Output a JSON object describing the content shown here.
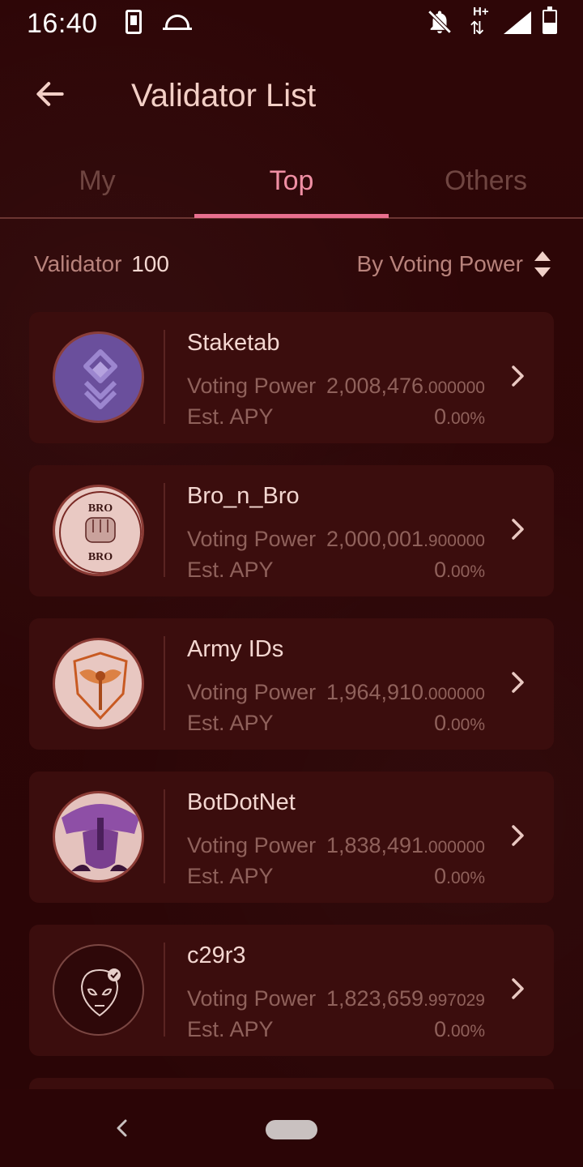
{
  "status_bar": {
    "time": "16:40",
    "icons": [
      "phone-icon",
      "dome-icon",
      "bell-off-icon",
      "hplus-data-icon",
      "signal-icon",
      "battery-icon"
    ],
    "network_label": "H+"
  },
  "header": {
    "back_icon": "arrow-left-icon",
    "title": "Validator List"
  },
  "tabs": [
    {
      "label": "My",
      "active": false
    },
    {
      "label": "Top",
      "active": true
    },
    {
      "label": "Others",
      "active": false
    }
  ],
  "list_header": {
    "validator_label": "Validator",
    "validator_count": "100",
    "sort_label": "By Voting Power",
    "sort_icon": "sort-updown-icon"
  },
  "labels": {
    "voting_power": "Voting Power",
    "est_apy": "Est. APY"
  },
  "validators": [
    {
      "name": "Staketab",
      "vp_int": "2,008,476",
      "vp_dec": ".000000",
      "apy_int": "0",
      "apy_dec": ".00%",
      "avatar": "staketab-logo"
    },
    {
      "name": "Bro_n_Bro",
      "vp_int": "2,000,001",
      "vp_dec": ".900000",
      "apy_int": "0",
      "apy_dec": ".00%",
      "avatar": "bro-n-bro-logo",
      "avatar_text_top": "BRO",
      "avatar_text_bottom": "BRO"
    },
    {
      "name": "Army IDs",
      "vp_int": "1,964,910",
      "vp_dec": ".000000",
      "apy_int": "0",
      "apy_dec": ".00%",
      "avatar": "army-ids-logo"
    },
    {
      "name": "BotDotNet",
      "vp_int": "1,838,491",
      "vp_dec": ".000000",
      "apy_int": "0",
      "apy_dec": ".00%",
      "avatar": "botdotnet-logo"
    },
    {
      "name": "c29r3",
      "vp_int": "1,823,659",
      "vp_dec": ".997029",
      "apy_int": "0",
      "apy_dec": ".00%",
      "avatar": "c29r3-alien-logo"
    }
  ],
  "colors": {
    "background": "#2b0506",
    "card": "#3b0d0d",
    "accent": "#e96f8f",
    "muted_text": "#8f615b"
  },
  "nav_bar": {
    "back_icon": "nav-back-icon",
    "home_icon": "nav-home-pill"
  }
}
